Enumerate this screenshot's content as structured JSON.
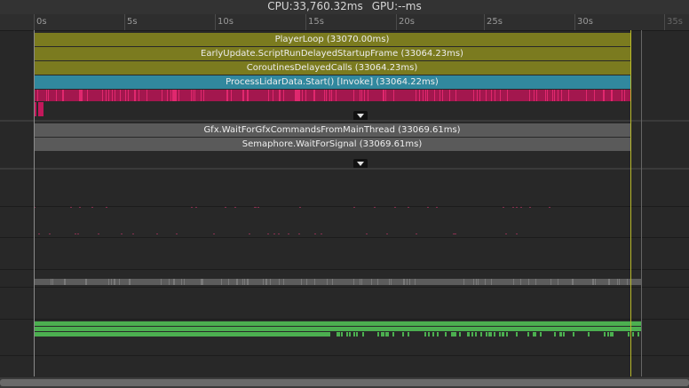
{
  "header": {
    "cpu_text": "CPU:33,760.32ms",
    "gpu_text": "GPU:--ms"
  },
  "ruler": {
    "labels": [
      "0s",
      "5s",
      "10s",
      "15s",
      "20s",
      "25s",
      "30s",
      "35s"
    ]
  },
  "main_thread": {
    "markers": [
      {
        "label": "PlayerLoop (33070.00ms)",
        "color": "olive"
      },
      {
        "label": "EarlyUpdate.ScriptRunDelayedStartupFrame (33064.23ms)",
        "color": "olive"
      },
      {
        "label": "CoroutinesDelayedCalls (33064.23ms)",
        "color": "olive"
      },
      {
        "label": "ProcessLidarData.Start() [Invoke] (33064.22ms)",
        "color": "teal"
      }
    ]
  },
  "render_thread": {
    "markers": [
      {
        "label": "Gfx.WaitForGfxCommandsFromMainThread (33069.61ms)",
        "color": "gray"
      },
      {
        "label": "Semaphore.WaitForSignal (33069.61ms)",
        "color": "gray"
      }
    ]
  },
  "colors": {
    "olive": "#7b7b1f",
    "teal": "#31889e",
    "magenta": "#c2185b",
    "green": "#4caf50",
    "playhead": "#b9b92a"
  },
  "icons": {
    "expand": "chevron-down-icon"
  }
}
